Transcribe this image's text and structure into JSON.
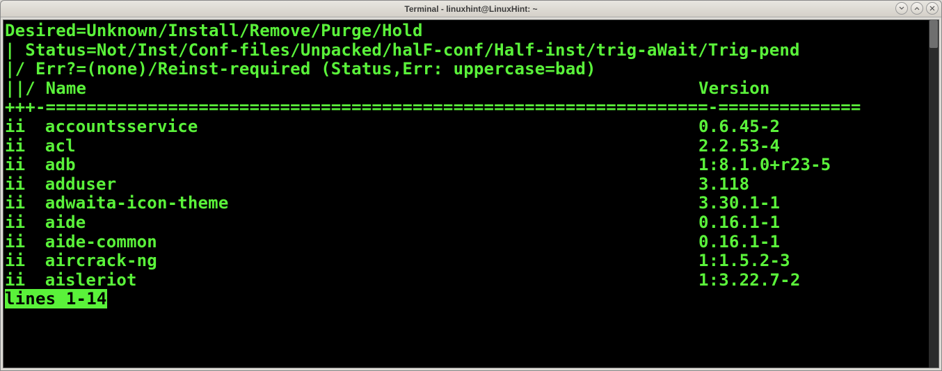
{
  "window": {
    "title": "Terminal - linuxhint@LinuxHint: ~"
  },
  "legend": {
    "line1": "Desired=Unknown/Install/Remove/Purge/Hold",
    "line2": "| Status=Not/Inst/Conf-files/Unpacked/halF-conf/Half-inst/trig-aWait/Trig-pend",
    "line3": "|/ Err?=(none)/Reinst-required (Status,Err: uppercase=bad)"
  },
  "header": {
    "cols": "||/ Name",
    "version": "Version",
    "sep_left": "+++-=================================================================-",
    "sep_right": "=============="
  },
  "packages": [
    {
      "status": "ii",
      "name": "accountsservice",
      "version": "0.6.45-2"
    },
    {
      "status": "ii",
      "name": "acl",
      "version": "2.2.53-4"
    },
    {
      "status": "ii",
      "name": "adb",
      "version": "1:8.1.0+r23-5"
    },
    {
      "status": "ii",
      "name": "adduser",
      "version": "3.118"
    },
    {
      "status": "ii",
      "name": "adwaita-icon-theme",
      "version": "3.30.1-1"
    },
    {
      "status": "ii",
      "name": "aide",
      "version": "0.16.1-1"
    },
    {
      "status": "ii",
      "name": "aide-common",
      "version": "0.16.1-1"
    },
    {
      "status": "ii",
      "name": "aircrack-ng",
      "version": "1:1.5.2-3"
    },
    {
      "status": "ii",
      "name": "aisleriot",
      "version": "1:3.22.7-2"
    }
  ],
  "pager": {
    "status": "lines 1-14"
  }
}
